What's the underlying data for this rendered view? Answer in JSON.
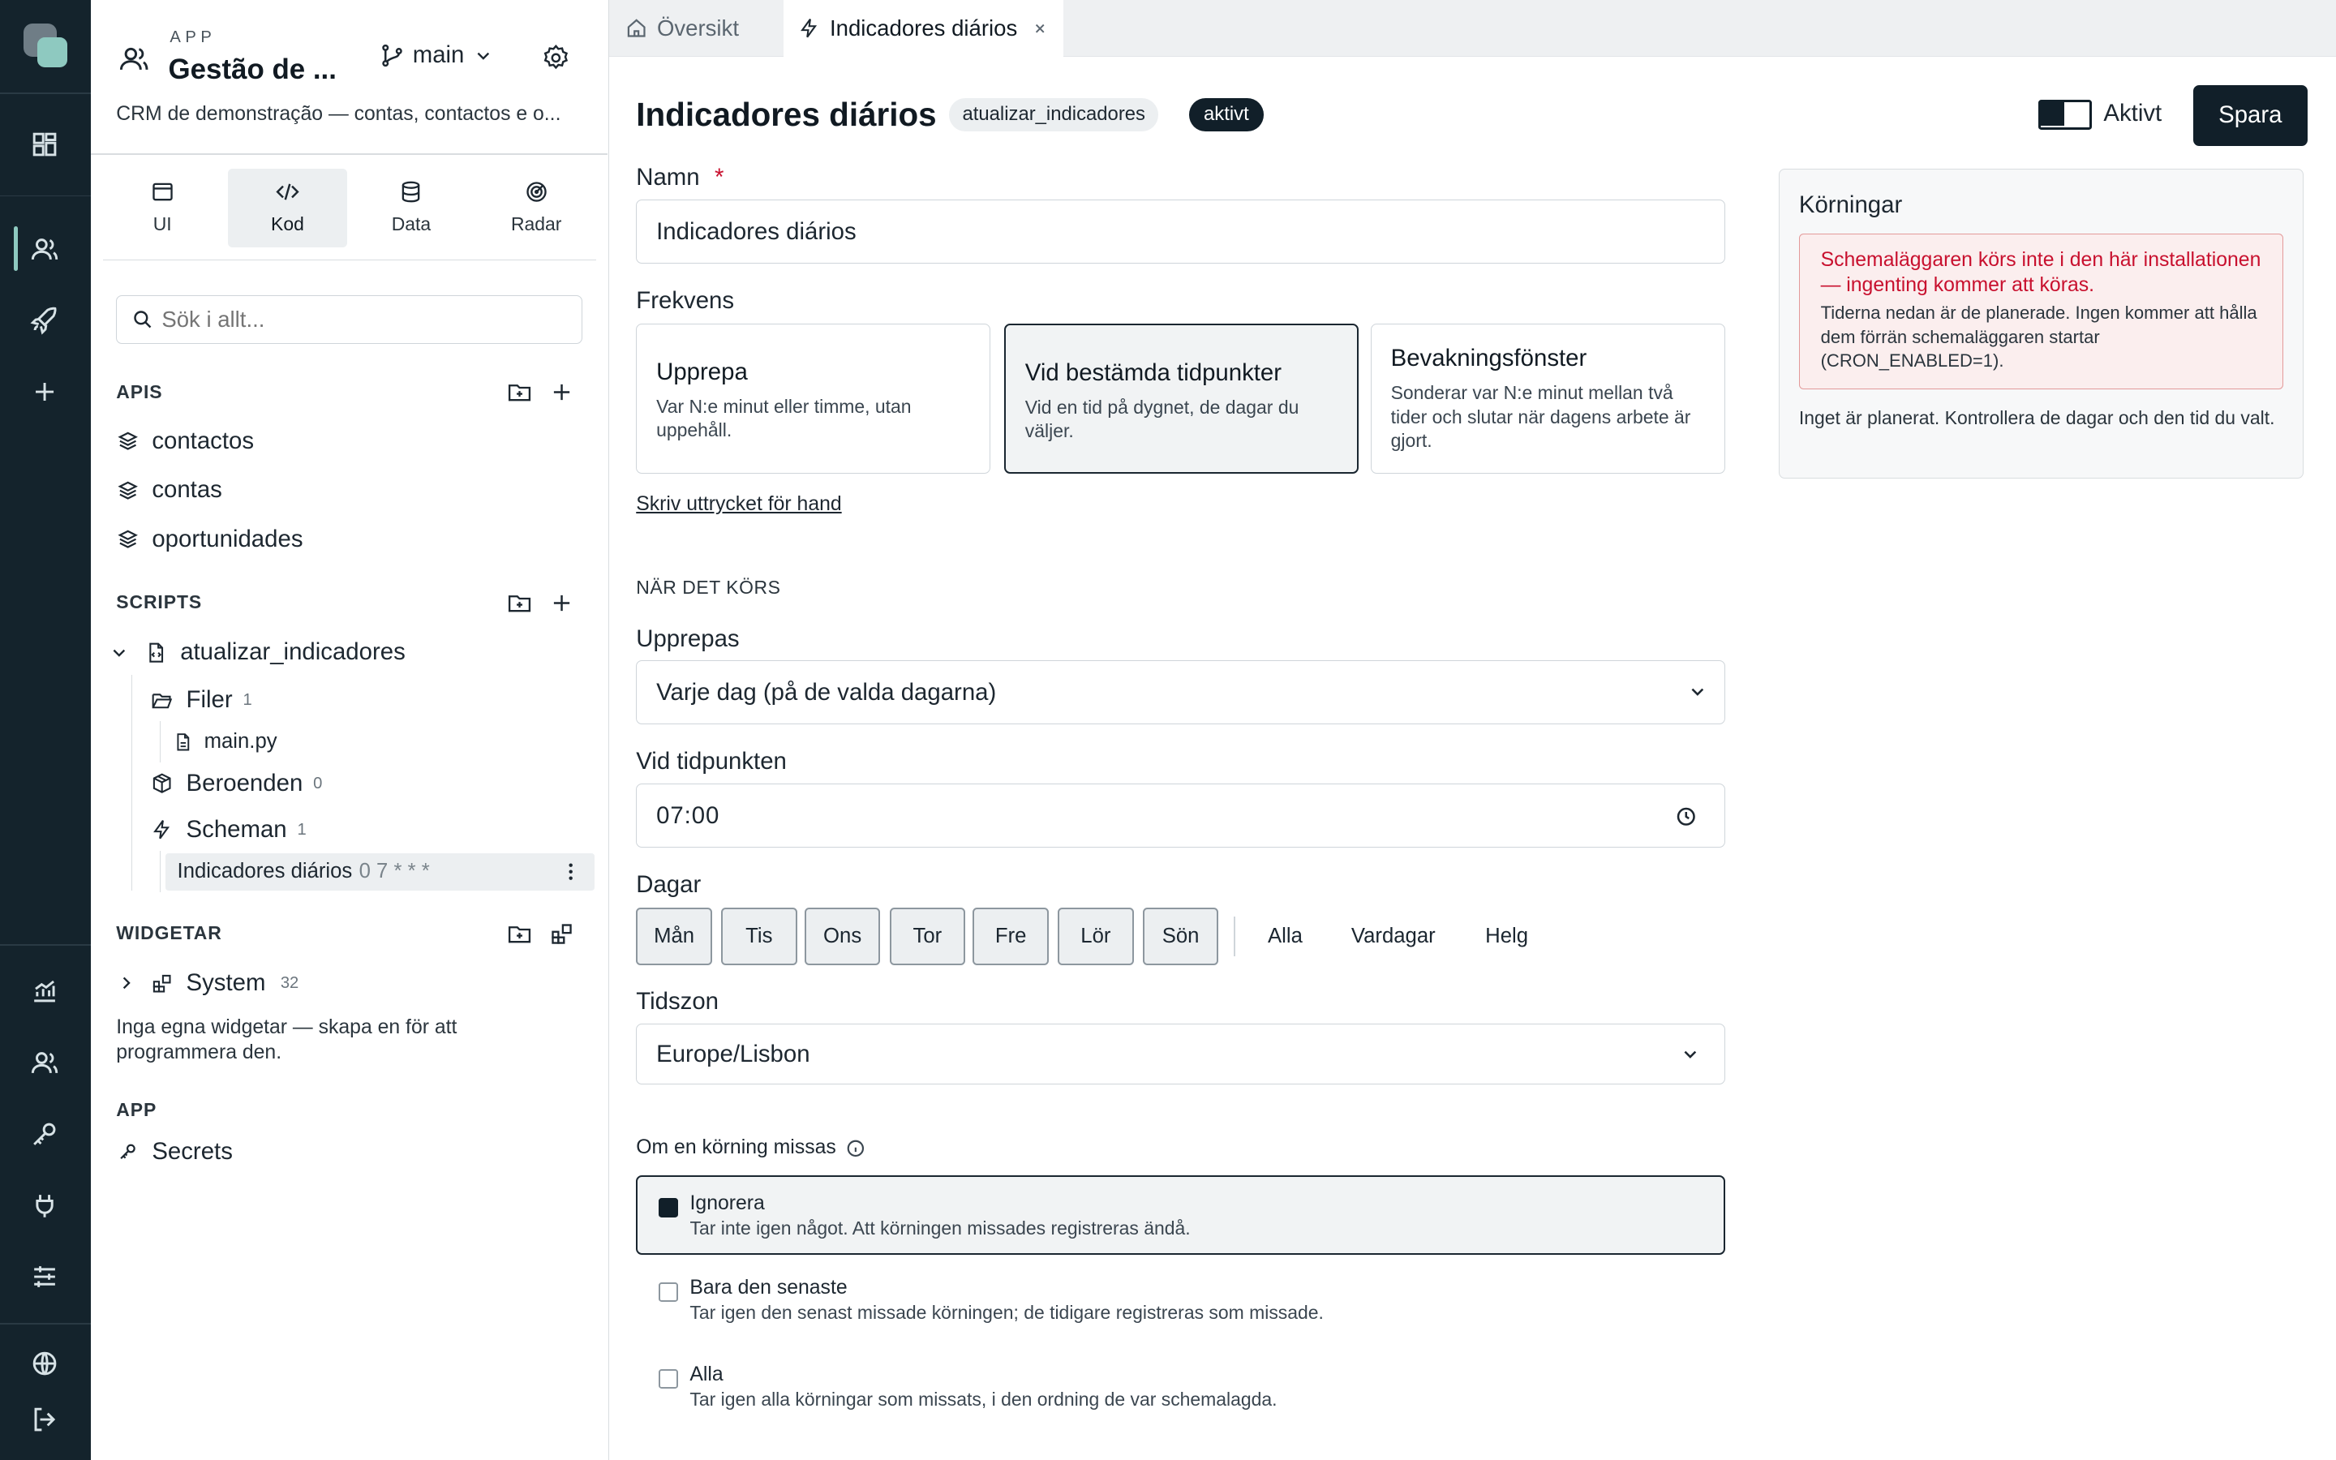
{
  "app": {
    "kicker": "APP",
    "name": "Gestão de ...",
    "branch": "main",
    "description": "CRM de demonstração — contas, contactos e o..."
  },
  "modes": [
    {
      "label": "UI",
      "icon": "window-icon"
    },
    {
      "label": "Kod",
      "icon": "code-icon"
    },
    {
      "label": "Data",
      "icon": "database-icon"
    },
    {
      "label": "Radar",
      "icon": "radar-icon"
    }
  ],
  "search": {
    "placeholder": "Sök i allt..."
  },
  "apis": {
    "title": "APIS",
    "items": [
      "contactos",
      "contas",
      "oportunidades"
    ]
  },
  "scripts": {
    "title": "SCRIPTS",
    "script_name": "atualizar_indicadores",
    "files_label": "Filer",
    "files_count": "1",
    "file": "main.py",
    "deps_label": "Beroenden",
    "deps_count": "0",
    "schedules_label": "Scheman",
    "schedules_count": "1",
    "schedule_name": "Indicadores diários",
    "schedule_cron": "0 7 * * *"
  },
  "widgets": {
    "title": "WIDGETAR",
    "system_label": "System",
    "system_count": "32",
    "empty_text": "Inga egna widgetar — skapa en för att programmera den."
  },
  "app_section": {
    "title": "APP",
    "secrets": "Secrets"
  },
  "tabs": [
    {
      "label": "Översikt"
    },
    {
      "label": "Indicadores diários"
    }
  ],
  "header": {
    "title": "Indicadores diários",
    "script_badge": "atualizar_indicadores",
    "status_badge": "aktivt",
    "toggle_label": "Aktivt",
    "save_label": "Spara"
  },
  "form": {
    "name_label": "Namn",
    "required_mark": "*",
    "name_value": "Indicadores diários",
    "frequency_label": "Frekvens",
    "frequency_options": [
      {
        "title": "Upprepa",
        "desc": "Var N:e minut eller timme, utan uppehåll."
      },
      {
        "title": "Vid bestämda tidpunkter",
        "desc": "Vid en tid på dygnet, de dagar du väljer."
      },
      {
        "title": "Bevakningsfönster",
        "desc": "Sonderar var N:e minut mellan två tider och slutar när dagens arbete är gjort."
      }
    ],
    "frequency_selected": "Vid bestämda tidpunkter",
    "manual_link": "Skriv uttrycket för hand",
    "when_section": "NÄR DET KÖRS",
    "repeat_label": "Upprepas",
    "repeat_value": "Varje dag (på de valda dagarna)",
    "time_label": "Vid tidpunkten",
    "time_value": "07:00",
    "days_label": "Dagar",
    "days": [
      "Mån",
      "Tis",
      "Ons",
      "Tor",
      "Fre",
      "Lör",
      "Sön"
    ],
    "day_presets": [
      "Alla",
      "Vardagar",
      "Helg"
    ],
    "timezone_label": "Tidszon",
    "timezone_value": "Europe/Lisbon",
    "missed_label": "Om en körning missas",
    "missed_options": [
      {
        "title": "Ignorera",
        "desc": "Tar inte igen något. Att körningen missades registreras ändå."
      },
      {
        "title": "Bara den senaste",
        "desc": "Tar igen den senast missade körningen; de tidigare registreras som missade."
      },
      {
        "title": "Alla",
        "desc": "Tar igen alla körningar som missats, i den ordning de var schemalagda."
      }
    ],
    "missed_selected": "Ignorera"
  },
  "runs": {
    "title": "Körningar",
    "alert_title": "Schemaläggaren körs inte i den här installationen — ingenting kommer att köras.",
    "alert_text": "Tiderna nedan är de planerade. Ingen kommer att hålla dem förrän schemaläggaren startar (CRON_ENABLED=1).",
    "empty_text": "Inget är planerat. Kontrollera de dagar och den tid du valt."
  },
  "colors": {
    "rail_bg": "#14232c",
    "accent_dark": "#111f29",
    "logo_teal": "#8ec9c0",
    "alert_red": "#c8102e",
    "alert_bg": "#fbeeee"
  }
}
